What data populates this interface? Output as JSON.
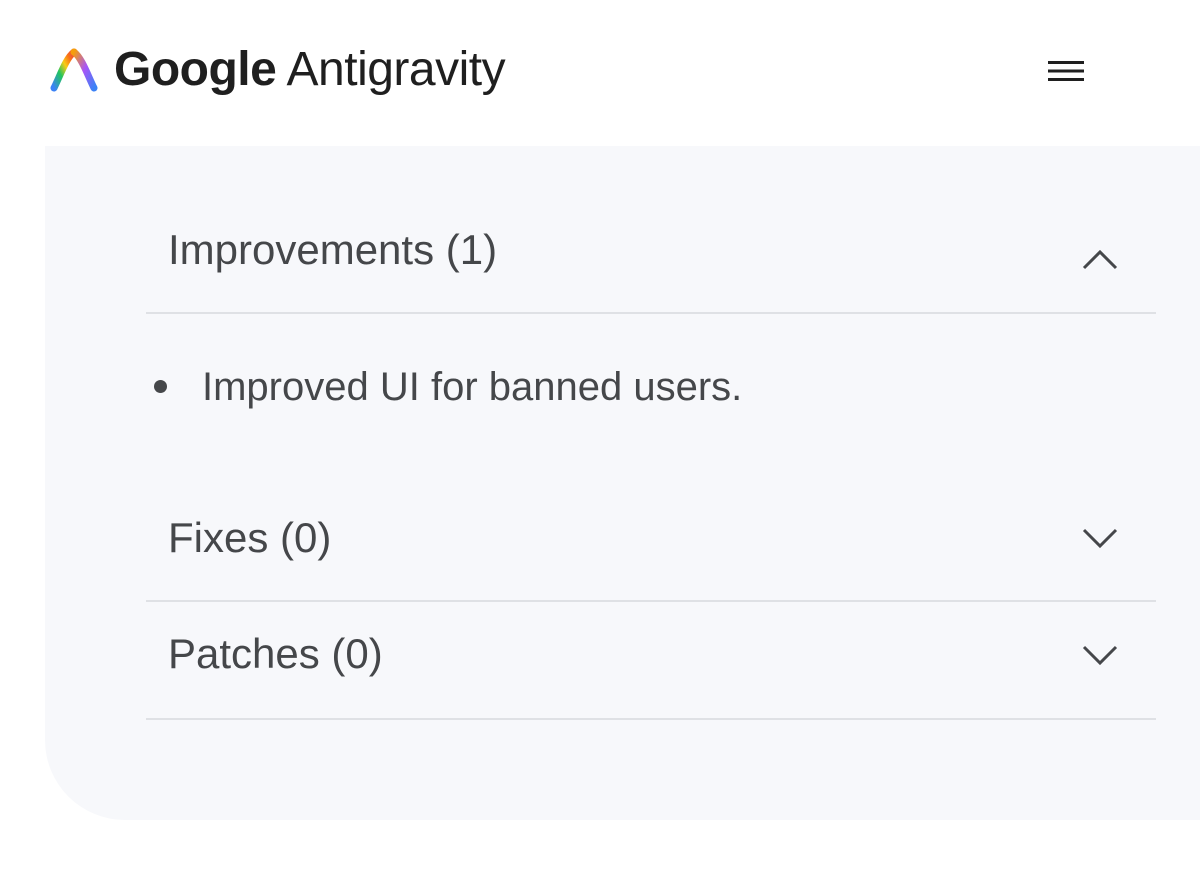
{
  "header": {
    "brand_google": "Google",
    "brand_product": "Antigravity",
    "logo_icon": "antigravity-logo-icon",
    "menu_icon": "hamburger-menu-icon"
  },
  "sections": [
    {
      "title": "Improvements (1)",
      "expanded": true,
      "chevron": "chevron-up-icon",
      "items": [
        "Improved UI for banned users."
      ]
    },
    {
      "title": "Fixes (0)",
      "expanded": false,
      "chevron": "chevron-down-icon",
      "items": []
    },
    {
      "title": "Patches (0)",
      "expanded": false,
      "chevron": "chevron-down-icon",
      "items": []
    }
  ],
  "colors": {
    "card_background": "#f7f8fb",
    "text": "#45474a",
    "divider": "#dfe1e5",
    "brand_text": "#1f1f1f"
  }
}
